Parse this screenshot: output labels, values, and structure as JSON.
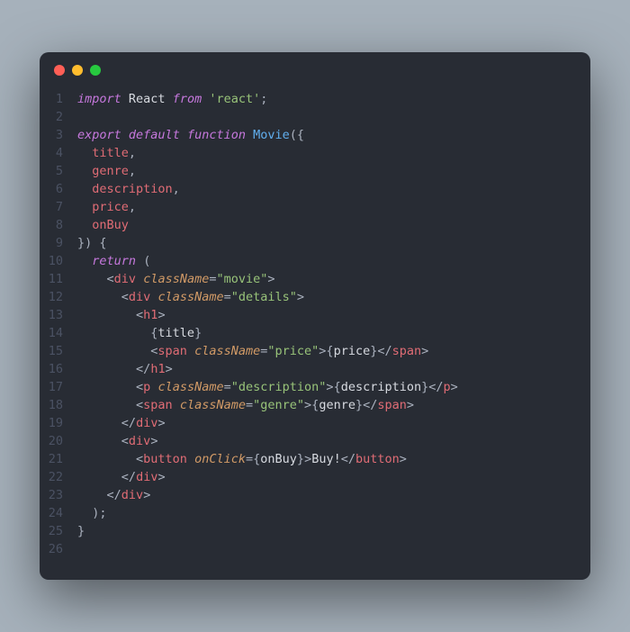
{
  "traffic_lights": {
    "red": "#ff5f56",
    "yellow": "#ffbd2e",
    "green": "#27c93f"
  },
  "line_count": 26,
  "code": {
    "import_kw": "import",
    "react": "React",
    "from_kw": "from",
    "react_str": "'react'",
    "semicolon": ";",
    "export_kw": "export",
    "default_kw": "default",
    "function_kw": "function",
    "func_name": "Movie",
    "lparen": "(",
    "rparen": ")",
    "lbrace": "{",
    "rbrace": "}",
    "comma": ",",
    "param_title": "title",
    "param_genre": "genre",
    "param_description": "description",
    "param_price": "price",
    "param_onBuy": "onBuy",
    "return_kw": "return",
    "div": "div",
    "h1": "h1",
    "span": "span",
    "p": "p",
    "button": "button",
    "className_attr": "className",
    "onClick_attr": "onClick",
    "movie_str": "\"movie\"",
    "details_str": "\"details\"",
    "price_str": "\"price\"",
    "description_str": "\"description\"",
    "genre_str": "\"genre\"",
    "expr_title": "title",
    "expr_price": "price",
    "expr_description": "description",
    "expr_genre": "genre",
    "expr_onBuy": "onBuy",
    "buy_text": "Buy!",
    "lt": "<",
    "gt": ">",
    "slash": "/",
    "eq": "="
  }
}
